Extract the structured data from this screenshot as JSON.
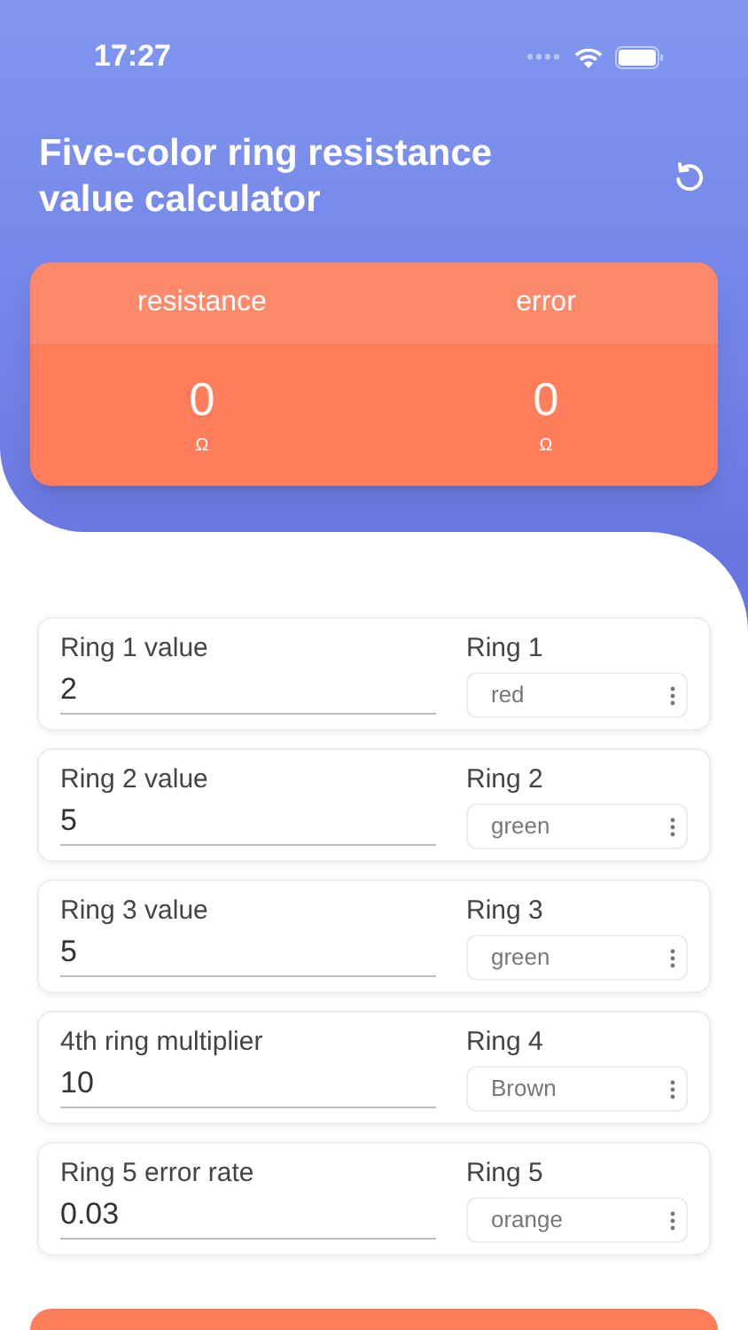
{
  "status_bar": {
    "time": "17:27"
  },
  "header": {
    "title": "Five-color ring resistance value calculator"
  },
  "result": {
    "columns": [
      {
        "label": "resistance",
        "value": "0",
        "unit": "Ω"
      },
      {
        "label": "error",
        "value": "0",
        "unit": "Ω"
      }
    ]
  },
  "rings": [
    {
      "value_label": "Ring 1 value",
      "value": "2",
      "select_label": "Ring 1",
      "color_name": "red"
    },
    {
      "value_label": "Ring 2 value",
      "value": "5",
      "select_label": "Ring 2",
      "color_name": "green"
    },
    {
      "value_label": "Ring 3 value",
      "value": "5",
      "select_label": "Ring 3",
      "color_name": "green"
    },
    {
      "value_label": "4th ring multiplier",
      "value": "10",
      "select_label": "Ring 4",
      "color_name": "Brown"
    },
    {
      "value_label": "Ring 5 error rate",
      "value": "0.03",
      "select_label": "Ring 5",
      "color_name": "orange"
    }
  ]
}
